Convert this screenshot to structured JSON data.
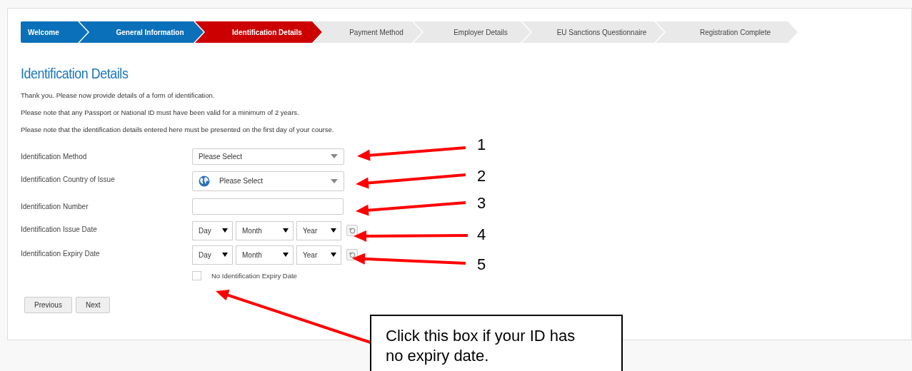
{
  "steps": [
    {
      "label": "Welcome",
      "completed": true,
      "selected": false
    },
    {
      "label": "General Information",
      "completed": true,
      "selected": false
    },
    {
      "label": "Identification Details",
      "completed": false,
      "selected": true
    },
    {
      "label": "Payment Method",
      "completed": false,
      "selected": false
    },
    {
      "label": "Employer Details",
      "completed": false,
      "selected": false
    },
    {
      "label": "EU Sanctions Questionnaire",
      "completed": false,
      "selected": false
    },
    {
      "label": "Registration Complete",
      "completed": false,
      "selected": false
    }
  ],
  "heading": "Identification Details",
  "intro": [
    "Thank you. Please now provide details of a form of identification.",
    "Please note that any Passport or National ID must have been valid for a minimum of 2 years.",
    "Please note that the identification details entered here must be presented on the first day of your course."
  ],
  "fields": [
    {
      "kind": "select",
      "label": "Identification Method",
      "value": "Please Select"
    },
    {
      "kind": "country",
      "label": "Identification Country of Issue",
      "value": "Please Select"
    },
    {
      "kind": "text",
      "label": "Identification Number"
    },
    {
      "kind": "date",
      "label": "Identification Issue Date",
      "parts": [
        "Day",
        "Month",
        "Year"
      ]
    },
    {
      "kind": "date",
      "label": "Identification Expiry Date",
      "parts": [
        "Day",
        "Month",
        "Year"
      ]
    }
  ],
  "no_expiry": {
    "label": "No Identification Expiry Date",
    "checked": false
  },
  "buttons": [
    "Previous",
    "Next"
  ],
  "annotations": {
    "markers": [
      "1",
      "2",
      "3",
      "4",
      "5"
    ],
    "callout": "Click this box if your ID has no expiry date."
  }
}
